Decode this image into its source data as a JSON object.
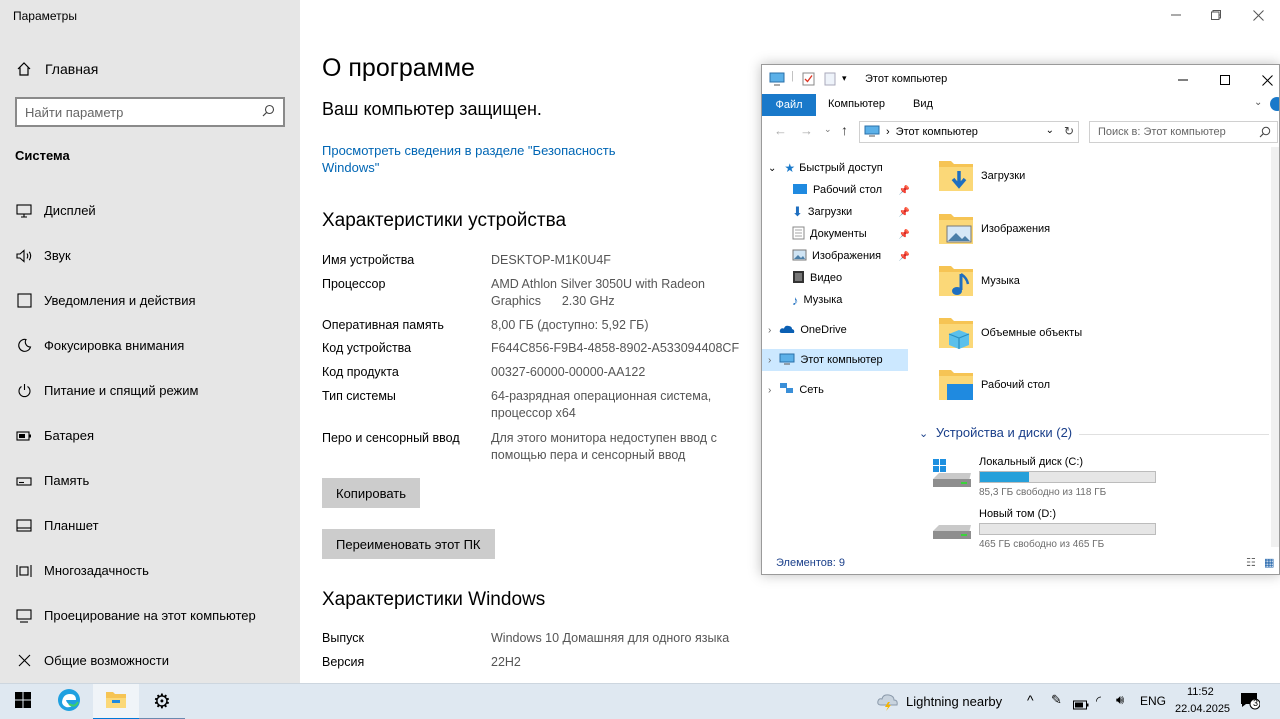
{
  "settings": {
    "app_title": "Параметры",
    "home_label": "Главная",
    "search_placeholder": "Найти параметр",
    "section_label": "Система",
    "nav_items": [
      {
        "label": "Дисплей",
        "icon": "display-icon"
      },
      {
        "label": "Звук",
        "icon": "sound-icon"
      },
      {
        "label": "Уведомления и действия",
        "icon": "notifications-icon"
      },
      {
        "label": "Фокусировка внимания",
        "icon": "focus-assist-icon"
      },
      {
        "label": "Питание и спящий режим",
        "icon": "power-icon"
      },
      {
        "label": "Батарея",
        "icon": "battery-icon"
      },
      {
        "label": "Память",
        "icon": "storage-icon"
      },
      {
        "label": "Планшет",
        "icon": "tablet-icon"
      },
      {
        "label": "Многозадачность",
        "icon": "multitasking-icon"
      },
      {
        "label": "Проецирование на этот компьютер",
        "icon": "projecting-icon"
      },
      {
        "label": "Общие возможности",
        "icon": "shared-experiences-icon"
      }
    ]
  },
  "about": {
    "title": "О программе",
    "protected": "Ваш компьютер защищен.",
    "security_link": "Просмотреть сведения в разделе \"Безопасность Windows\"",
    "device_specs_heading": "Характеристики устройства",
    "device_specs": [
      {
        "key": "Имя устройства",
        "value": "DESKTOP-M1K0U4F"
      },
      {
        "key": "Процессор",
        "value": "AMD Athlon Silver 3050U with Radeon Graphics      2.30 GHz"
      },
      {
        "key": "Оперативная память",
        "value": "8,00 ГБ (доступно: 5,92 ГБ)"
      },
      {
        "key": "Код устройства",
        "value": "F644C856-F9B4-4858-8902-A533094408CF"
      },
      {
        "key": "Код продукта",
        "value": "00327-60000-00000-AA122"
      },
      {
        "key": "Тип системы",
        "value": "64-разрядная операционная система, процессор x64"
      },
      {
        "key": "Перо и сенсорный ввод",
        "value": "Для этого монитора недоступен ввод с помощью пера и сенсорный ввод"
      }
    ],
    "copy_button": "Копировать",
    "rename_button": "Переименовать этот ПК",
    "windows_specs_heading": "Характеристики Windows",
    "windows_specs": [
      {
        "key": "Выпуск",
        "value": "Windows 10 Домашняя для одного языка"
      },
      {
        "key": "Версия",
        "value": "22H2"
      }
    ]
  },
  "explorer": {
    "title": "Этот компьютер",
    "ribbon": {
      "file": "Файл",
      "computer": "Компьютер",
      "view": "Вид"
    },
    "address": "Этот компьютер",
    "search_placeholder": "Поиск в: Этот компьютер",
    "quick_access": "Быстрый доступ",
    "quick_items": [
      {
        "label": "Рабочий стол",
        "icon": "desktop-icon"
      },
      {
        "label": "Загрузки",
        "icon": "downloads-icon"
      },
      {
        "label": "Документы",
        "icon": "documents-icon"
      },
      {
        "label": "Изображения",
        "icon": "pictures-icon"
      },
      {
        "label": "Видео",
        "icon": "videos-icon"
      },
      {
        "label": "Музыка",
        "icon": "music-icon"
      }
    ],
    "onedrive": "OneDrive",
    "this_pc": "Этот компьютер",
    "network": "Сеть",
    "folders": [
      {
        "label": "Загрузки",
        "icon": "downloads-folder-icon"
      },
      {
        "label": "Изображения",
        "icon": "pictures-folder-icon"
      },
      {
        "label": "Музыка",
        "icon": "music-folder-icon"
      },
      {
        "label": "Объемные объекты",
        "icon": "3d-objects-folder-icon"
      },
      {
        "label": "Рабочий стол",
        "icon": "desktop-folder-icon"
      }
    ],
    "devices_heading": "Устройства и диски (2)",
    "drives": [
      {
        "label": "Локальный диск (C:)",
        "free": "85,3 ГБ свободно из 118 ГБ",
        "used_fraction": 0.28
      },
      {
        "label": "Новый том (D:)",
        "free": "465 ГБ свободно из 465 ГБ",
        "used_fraction": 0.0
      }
    ],
    "status": "Элементов: 9"
  },
  "taskbar": {
    "weather": "Lightning nearby",
    "language": "ENG",
    "time": "11:52",
    "date": "22.04.2025",
    "notifications_count": "3"
  },
  "colors": {
    "accent": "#0078d7",
    "link": "#0066b4",
    "sidebar_bg": "#e6e6e6",
    "taskbar_bg": "#dfe8f1",
    "drive_bar": "#26a0da"
  }
}
